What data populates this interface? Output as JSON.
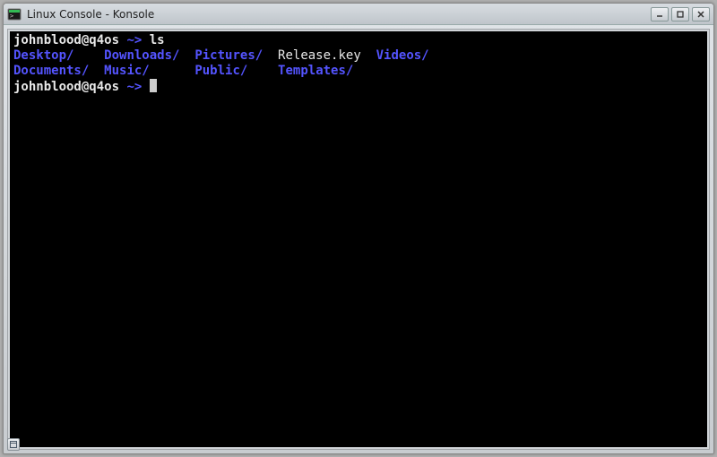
{
  "window": {
    "title": "Linux Console - Konsole"
  },
  "terminal": {
    "prompt1_userhost": "johnblood@q4os",
    "prompt1_path": "~>",
    "prompt1_cmd": "ls",
    "row1": {
      "c0": "Desktop/",
      "c1": "Downloads/",
      "c2": "Pictures/",
      "c3": "Release.key",
      "c4": "Videos/"
    },
    "row2": {
      "c0": "Documents/",
      "c1": "Music/",
      "c2": "Public/",
      "c3": "Templates/"
    },
    "prompt2_userhost": "johnblood@q4os",
    "prompt2_path": "~>"
  },
  "col": {
    "pad01": "    ",
    "pad12": "  ",
    "pad23": "  ",
    "pad34": "  ",
    "pad01b": "  ",
    "pad12b": "      ",
    "pad23b": "    ",
    "pad34b": ""
  }
}
